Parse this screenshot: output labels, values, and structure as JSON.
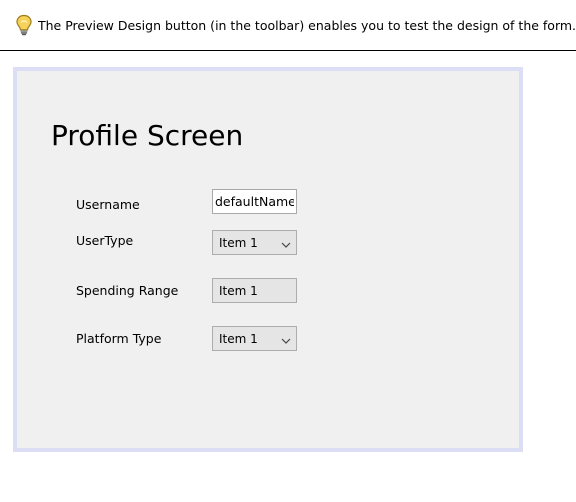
{
  "hint": {
    "icon": "lightbulb-icon",
    "text": "The Preview Design button (in the toolbar) enables you to test the design of the form."
  },
  "form": {
    "title": "Profile Screen",
    "username": {
      "label": "Username",
      "value": "defaultName"
    },
    "user_type": {
      "label": "UserType",
      "selected": "Item 1"
    },
    "spending_range": {
      "label": "Spending Range",
      "selected": "Item 1"
    },
    "platform_type": {
      "label": "Platform Type",
      "selected": "Item 1"
    }
  },
  "colors": {
    "frame_border": "#dcdef5",
    "form_background": "#f0f0f0",
    "combo_background": "#e5e5e5"
  }
}
